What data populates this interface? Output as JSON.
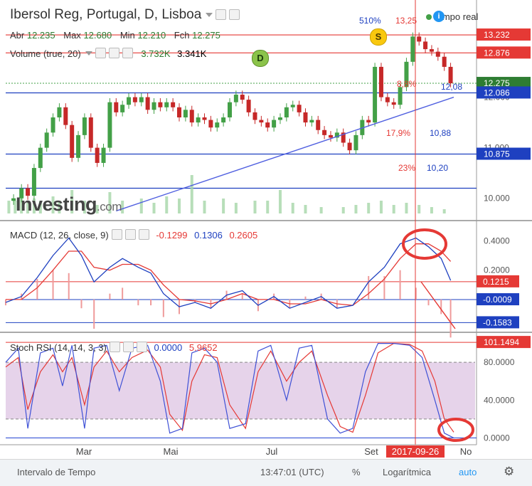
{
  "header": {
    "title": "Ibersol Reg, Portugal, D, Lisboa",
    "ohlc": [
      {
        "label": "Abr",
        "value": "12.235"
      },
      {
        "label": "Max",
        "value": "12.680"
      },
      {
        "label": "Min",
        "value": "12.210"
      },
      {
        "label": "Fch",
        "value": "12.275"
      }
    ],
    "volume_label": "Volume (true, 20)",
    "volume_value1": "3.732K",
    "volume_value2": "3.341K",
    "realtime": "tempo real"
  },
  "markers": {
    "dividend": "D",
    "split": "S",
    "info": "i"
  },
  "annotations": {
    "fib_top_pct": "510%",
    "fib_top_val": "13,25",
    "fib1_pct": "8,8%",
    "fib1_val": "12,08",
    "fib2_pct": "17,9%",
    "fib2_val": "10,88",
    "fib3_pct": "23%",
    "fib3_val": "10,20"
  },
  "logo": {
    "text": "Investing",
    "domain": ".com"
  },
  "macd": {
    "label": "MACD (12, 26, close, 9)",
    "v1": "-0.1299",
    "v2": "0.1306",
    "v3": "0.2605"
  },
  "stoch": {
    "label": "Stoch RSI (14, 14, 3, 3)",
    "v1": "0.0000",
    "v2": "5.9652"
  },
  "bottom": {
    "interval": "Intervalo de Tempo",
    "time": "13:47:01 (UTC)",
    "pct": "%",
    "log": "Logarítmica",
    "auto": "auto"
  },
  "colors": {
    "up": "#43a047",
    "down": "#c62828",
    "macd": "#1e40c0",
    "signal": "#e53935",
    "hline_blue": "#1e3fd0",
    "hline_red": "#e53935",
    "stoch_band": "#e6d3ea"
  },
  "chart_data": {
    "type": "candlestick",
    "x_ticks": [
      "Mar",
      "Mai",
      "Jul",
      "Set",
      "No"
    ],
    "cursor_date": "2017-09-26",
    "price_axis": {
      "range": [
        9.7,
        13.5
      ],
      "ticks": [
        10.0,
        11.0,
        12.0
      ],
      "tick_labels": [
        "10.000",
        "11.000",
        "12.000"
      ],
      "labels": [
        {
          "value": 13.232,
          "text": "13.232",
          "color": "#e53935"
        },
        {
          "value": 12.876,
          "text": "12.876",
          "color": "#e53935"
        },
        {
          "value": 12.275,
          "text": "12.275",
          "color": "#2e7d32"
        },
        {
          "value": 12.086,
          "text": "12.086",
          "color": "#1e40c0"
        },
        {
          "value": 10.875,
          "text": "10.875",
          "color": "#1e40c0"
        }
      ],
      "hlines": [
        {
          "value": 13.232,
          "color": "#e53935"
        },
        {
          "value": 12.876,
          "color": "#e53935"
        },
        {
          "value": 12.086,
          "color": "#1e40c0"
        },
        {
          "value": 10.875,
          "color": "#1e40c0"
        },
        {
          "value": 10.2,
          "color": "#1e40c0"
        }
      ],
      "last_price_dotted": 12.275
    },
    "close_path": [
      [
        0,
        9.95
      ],
      [
        5,
        10.0
      ],
      [
        10,
        10.2
      ],
      [
        14,
        10.05
      ],
      [
        18,
        10.6
      ],
      [
        22,
        11.0
      ],
      [
        26,
        11.3
      ],
      [
        30,
        11.6
      ],
      [
        34,
        11.8
      ],
      [
        38,
        11.45
      ],
      [
        42,
        10.8
      ],
      [
        46,
        11.25
      ],
      [
        50,
        11.6
      ],
      [
        54,
        11.0
      ],
      [
        58,
        10.7
      ],
      [
        62,
        11.0
      ],
      [
        66,
        11.9
      ],
      [
        70,
        11.7
      ],
      [
        74,
        11.85
      ],
      [
        78,
        12.0
      ],
      [
        82,
        11.9
      ],
      [
        86,
        12.0
      ],
      [
        90,
        11.75
      ],
      [
        94,
        11.9
      ],
      [
        98,
        11.8
      ],
      [
        102,
        11.9
      ],
      [
        106,
        11.8
      ],
      [
        110,
        11.6
      ],
      [
        114,
        11.75
      ],
      [
        118,
        11.5
      ],
      [
        122,
        11.6
      ],
      [
        126,
        11.55
      ],
      [
        130,
        11.4
      ],
      [
        134,
        11.5
      ],
      [
        138,
        11.6
      ],
      [
        142,
        11.9
      ],
      [
        146,
        12.05
      ],
      [
        150,
        11.95
      ],
      [
        154,
        11.7
      ],
      [
        158,
        11.55
      ],
      [
        162,
        11.5
      ],
      [
        166,
        11.4
      ],
      [
        170,
        11.55
      ],
      [
        174,
        11.6
      ],
      [
        178,
        11.8
      ],
      [
        182,
        11.85
      ],
      [
        186,
        11.7
      ],
      [
        190,
        11.5
      ],
      [
        194,
        11.55
      ],
      [
        198,
        11.35
      ],
      [
        202,
        11.25
      ],
      [
        206,
        11.2
      ],
      [
        210,
        11.3
      ],
      [
        214,
        11.1
      ],
      [
        218,
        10.95
      ],
      [
        222,
        11.25
      ],
      [
        226,
        11.55
      ],
      [
        230,
        11.5
      ],
      [
        234,
        12.6
      ],
      [
        238,
        12.0
      ],
      [
        242,
        11.9
      ],
      [
        246,
        11.85
      ],
      [
        250,
        12.2
      ],
      [
        254,
        12.7
      ],
      [
        258,
        13.2
      ],
      [
        262,
        13.1
      ],
      [
        266,
        12.95
      ],
      [
        270,
        12.9
      ],
      [
        274,
        12.8
      ],
      [
        278,
        12.6
      ],
      [
        282,
        12.275
      ]
    ],
    "volume": [
      [
        2,
        0.3
      ],
      [
        6,
        0.3
      ],
      [
        10,
        0.5
      ],
      [
        14,
        0.25
      ],
      [
        18,
        0.35
      ],
      [
        22,
        0.3
      ],
      [
        30,
        0.4
      ],
      [
        34,
        0.3
      ],
      [
        42,
        0.55
      ],
      [
        50,
        0.3
      ],
      [
        58,
        0.2
      ],
      [
        66,
        0.5
      ],
      [
        74,
        0.3
      ],
      [
        86,
        0.35
      ],
      [
        94,
        0.25
      ],
      [
        102,
        0.4
      ],
      [
        110,
        0.35
      ],
      [
        118,
        0.9
      ],
      [
        126,
        0.3
      ],
      [
        138,
        0.35
      ],
      [
        146,
        0.25
      ],
      [
        158,
        0.3
      ],
      [
        166,
        0.3
      ],
      [
        174,
        0.55
      ],
      [
        182,
        0.25
      ],
      [
        190,
        0.2
      ],
      [
        200,
        0.15
      ],
      [
        214,
        0.15
      ],
      [
        222,
        0.2
      ],
      [
        230,
        0.25
      ],
      [
        238,
        0.3
      ],
      [
        246,
        0.2
      ],
      [
        254,
        0.25
      ],
      [
        262,
        0.2
      ],
      [
        270,
        0.15
      ],
      [
        278,
        0.1
      ]
    ],
    "trendline": [
      [
        70,
        9.75
      ],
      [
        284,
        12.0
      ]
    ],
    "macd_series": {
      "ticks": [
        0.4,
        0.2
      ],
      "tick_labels": [
        "0.4000",
        "0.2000"
      ],
      "value_labels": [
        {
          "value": 0.1215,
          "text": "0.1215",
          "color": "#e53935"
        },
        {
          "value": -0.0009,
          "text": "-0.0009",
          "color": "#1e40c0"
        },
        {
          "value": -0.1583,
          "text": "-0.1583",
          "color": "#1e40c0"
        }
      ],
      "hlines": [
        {
          "value": 0.1215,
          "color": "#e53935"
        },
        {
          "value": -0.0009,
          "color": "#1e40c0"
        },
        {
          "value": -0.1583,
          "color": "#1e40c0"
        }
      ],
      "range": [
        -0.2,
        0.5
      ],
      "macd": [
        [
          0,
          -0.02
        ],
        [
          10,
          0.02
        ],
        [
          20,
          0.15
        ],
        [
          30,
          0.3
        ],
        [
          40,
          0.42
        ],
        [
          48,
          0.3
        ],
        [
          56,
          0.12
        ],
        [
          66,
          0.22
        ],
        [
          74,
          0.28
        ],
        [
          84,
          0.22
        ],
        [
          92,
          0.18
        ],
        [
          100,
          0.04
        ],
        [
          110,
          -0.05
        ],
        [
          120,
          -0.02
        ],
        [
          130,
          -0.06
        ],
        [
          140,
          0.03
        ],
        [
          150,
          0.06
        ],
        [
          160,
          -0.04
        ],
        [
          170,
          0.02
        ],
        [
          180,
          -0.06
        ],
        [
          190,
          -0.02
        ],
        [
          200,
          0.02
        ],
        [
          210,
          -0.06
        ],
        [
          220,
          -0.04
        ],
        [
          230,
          0.12
        ],
        [
          240,
          0.22
        ],
        [
          250,
          0.38
        ],
        [
          260,
          0.42
        ],
        [
          268,
          0.36
        ],
        [
          276,
          0.28
        ],
        [
          282,
          0.13
        ]
      ],
      "signal": [
        [
          0,
          0.0
        ],
        [
          10,
          0.0
        ],
        [
          20,
          0.08
        ],
        [
          30,
          0.2
        ],
        [
          40,
          0.33
        ],
        [
          48,
          0.33
        ],
        [
          56,
          0.22
        ],
        [
          66,
          0.2
        ],
        [
          74,
          0.24
        ],
        [
          84,
          0.24
        ],
        [
          92,
          0.2
        ],
        [
          100,
          0.1
        ],
        [
          110,
          0.0
        ],
        [
          120,
          -0.01
        ],
        [
          130,
          -0.03
        ],
        [
          140,
          0.0
        ],
        [
          150,
          0.04
        ],
        [
          160,
          0.0
        ],
        [
          170,
          0.0
        ],
        [
          180,
          -0.03
        ],
        [
          190,
          -0.03
        ],
        [
          200,
          0.0
        ],
        [
          210,
          -0.03
        ],
        [
          220,
          -0.04
        ],
        [
          230,
          0.04
        ],
        [
          240,
          0.14
        ],
        [
          250,
          0.28
        ],
        [
          260,
          0.38
        ],
        [
          268,
          0.38
        ],
        [
          276,
          0.33
        ],
        [
          282,
          0.26
        ]
      ]
    },
    "stoch_series": {
      "ticks": [
        80,
        40,
        0
      ],
      "tick_labels": [
        "80.0000",
        "40.0000",
        "0.0000"
      ],
      "value_labels": [
        {
          "value": 101.1494,
          "text": "101.1494",
          "color": "#e53935"
        }
      ],
      "range": [
        -5,
        105
      ],
      "band": [
        20,
        80
      ],
      "k": [
        [
          0,
          80
        ],
        [
          8,
          95
        ],
        [
          14,
          10
        ],
        [
          22,
          90
        ],
        [
          30,
          95
        ],
        [
          36,
          55
        ],
        [
          42,
          98
        ],
        [
          50,
          10
        ],
        [
          56,
          95
        ],
        [
          64,
          98
        ],
        [
          72,
          50
        ],
        [
          80,
          95
        ],
        [
          90,
          98
        ],
        [
          98,
          60
        ],
        [
          104,
          5
        ],
        [
          112,
          10
        ],
        [
          118,
          90
        ],
        [
          126,
          95
        ],
        [
          134,
          80
        ],
        [
          142,
          10
        ],
        [
          152,
          15
        ],
        [
          160,
          92
        ],
        [
          168,
          98
        ],
        [
          178,
          40
        ],
        [
          186,
          95
        ],
        [
          194,
          98
        ],
        [
          204,
          20
        ],
        [
          212,
          5
        ],
        [
          220,
          10
        ],
        [
          228,
          70
        ],
        [
          236,
          100
        ],
        [
          246,
          100
        ],
        [
          256,
          98
        ],
        [
          264,
          85
        ],
        [
          272,
          40
        ],
        [
          278,
          5
        ],
        [
          284,
          0
        ]
      ],
      "d": [
        [
          0,
          75
        ],
        [
          8,
          85
        ],
        [
          14,
          30
        ],
        [
          22,
          70
        ],
        [
          30,
          88
        ],
        [
          36,
          70
        ],
        [
          42,
          85
        ],
        [
          50,
          35
        ],
        [
          56,
          75
        ],
        [
          64,
          92
        ],
        [
          72,
          70
        ],
        [
          80,
          85
        ],
        [
          90,
          93
        ],
        [
          98,
          75
        ],
        [
          104,
          25
        ],
        [
          112,
          8
        ],
        [
          118,
          60
        ],
        [
          126,
          88
        ],
        [
          134,
          85
        ],
        [
          142,
          35
        ],
        [
          152,
          10
        ],
        [
          160,
          70
        ],
        [
          168,
          92
        ],
        [
          178,
          60
        ],
        [
          186,
          80
        ],
        [
          194,
          92
        ],
        [
          204,
          45
        ],
        [
          212,
          12
        ],
        [
          220,
          6
        ],
        [
          228,
          45
        ],
        [
          236,
          90
        ],
        [
          246,
          100
        ],
        [
          256,
          99
        ],
        [
          264,
          92
        ],
        [
          272,
          60
        ],
        [
          278,
          20
        ],
        [
          284,
          6
        ]
      ]
    }
  }
}
